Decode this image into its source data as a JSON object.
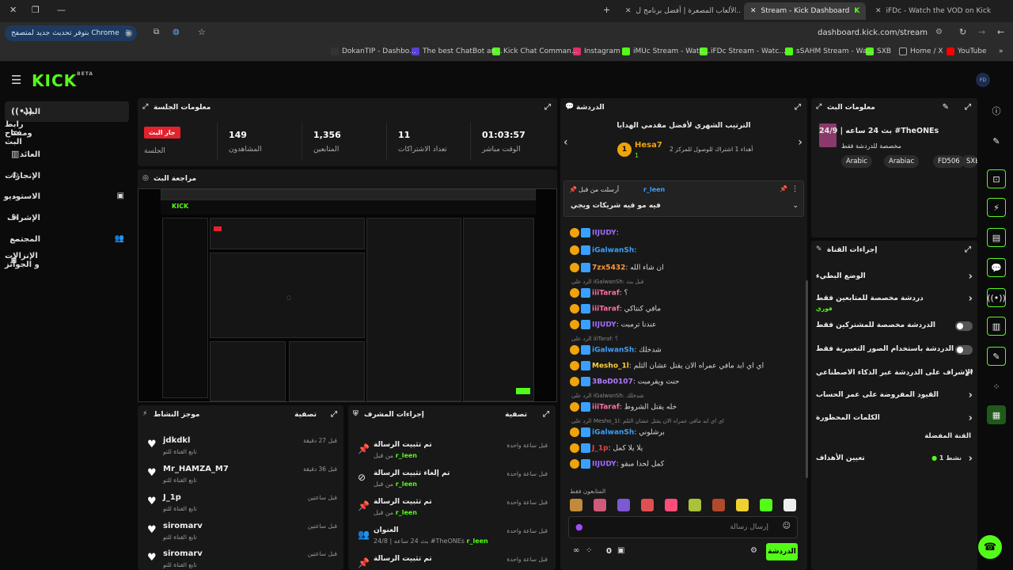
{
  "browser": {
    "tabs": [
      {
        "label": "iFDc - Watch the VOD on Kick"
      },
      {
        "label": "Stream - Kick Dashboard"
      },
      {
        "label": "الألعاب المصعرة | أفضل برنامج ل..."
      }
    ],
    "update_label": "بتوفر تحديث جديد لمتصفح Chrome",
    "url": "dashboard.kick.com/stream",
    "bookmarks": [
      "YouTube",
      "Home / X",
      "SXB",
      "sSAHM Stream - Wa...",
      "iFDc Stream - Watc...",
      "iMUc Stream - Watc...",
      "Instagram",
      "Kick Chat Comman...",
      "The best ChatBot an...",
      "DokanTIP - Dashbo..."
    ]
  },
  "nav": {
    "logo": "KICK",
    "logo_badge": "BETA",
    "avatar": "FD"
  },
  "sidebar": {
    "items": [
      {
        "label": "البث",
        "icon": "live-icon"
      },
      {
        "label": "رابط ومفتاح البث",
        "icon": "link-icon"
      },
      {
        "label": "العائد",
        "icon": "revenue-icon"
      },
      {
        "label": "الإنجازات",
        "icon": "trophy-icon"
      },
      {
        "label": "الاستوديو",
        "icon": "studio-icon"
      },
      {
        "label": "الإشراف",
        "icon": "wrench-icon"
      },
      {
        "label": "المجتمع",
        "icon": "community-icon"
      },
      {
        "label": "الإنزالات و الجوائز",
        "icon": "gift-icon"
      }
    ]
  },
  "session": {
    "title": "معلومات الجلسة",
    "badge": "جار البث",
    "badge_label": "الجلسة",
    "stats": [
      {
        "value": "149",
        "label": "المشاهدون"
      },
      {
        "value": "1,356",
        "label": "المتابعين"
      },
      {
        "value": "11",
        "label": "تعداد الاشتراكات"
      },
      {
        "value": "01:03:57",
        "label": "الوقت مباشر"
      }
    ]
  },
  "preview": {
    "title": "مراجعة البث"
  },
  "activity": {
    "title": "موجز النشاط",
    "filter": "تصفية",
    "rows": [
      {
        "name": "jdkdkl",
        "sub": "تابع القناة للتو",
        "time": "قبل 27 دقيقة"
      },
      {
        "name": "Mr_HAMZA_M7",
        "sub": "تابع القناة للتو",
        "time": "قبل 36 دقيقة"
      },
      {
        "name": "J_1p",
        "sub": "تابع القناة للتو",
        "time": "قبل ساعتين"
      },
      {
        "name": "siromarv",
        "sub": "تابع القناة للتو",
        "time": "قبل ساعتين"
      },
      {
        "name": "siromarv",
        "sub": "تابع القناة للتو",
        "time": "قبل ساعتين"
      }
    ]
  },
  "modactions": {
    "title": "إجراءات المشرف",
    "filter": "تصفية",
    "rows": [
      {
        "title": "تم تثبيت الرسالة",
        "by": "من قبل",
        "user": "r_leen",
        "time": "قبل ساعة واحدة",
        "icon": "pin-icon"
      },
      {
        "title": "تم إلغاء تثبيت الرسالة",
        "by": "من قبل",
        "user": "r_leen",
        "time": "قبل ساعة واحدة",
        "icon": "unpin-icon"
      },
      {
        "title": "تم تثبيت الرسالة",
        "by": "من قبل",
        "user": "r_leen",
        "time": "قبل ساعة واحدة",
        "icon": "pin-icon"
      },
      {
        "title": "العنوان",
        "by": "بث 24 ساعه | 24/8 #TheONEs",
        "user": "r_leen",
        "time": "قبل ساعة واحدة",
        "icon": "title-icon"
      },
      {
        "title": "تم تثبيت الرسالة",
        "by": "",
        "user": "",
        "time": "قبل ساعة واحدة",
        "icon": "pin-icon"
      }
    ]
  },
  "chat": {
    "title": "الدردشة",
    "leaderboard_title": "الترتيب الشهري لأفضل مقدمي الهدايا",
    "leader_name": "Hesa7",
    "leader_rank": "1",
    "leader_count": "1",
    "leader_sub": "أهداء 1 اشتراك للوصول للمركز 2",
    "pinned_by": "أرسلت من قبل",
    "pinned_user": "r_leen",
    "pinned_text": "فيه مو فيه شريكات ويجي",
    "messages": [
      {
        "user": "IIJUDY",
        "color": "#a16bff",
        "text": ""
      },
      {
        "user": "iGalwanSh",
        "color": "#3aa0ff",
        "text": ""
      },
      {
        "user": "7zx5432",
        "color": "#ff9b3d",
        "text": "ان شاء الله"
      },
      {
        "reply": "الرد على iGalwanSh: قبل بث",
        "user": "iiiTaraf",
        "color": "#ff6fa8",
        "text": "؟"
      },
      {
        "user": "iiiTaraf",
        "color": "#ff6fa8",
        "text": "مافي كنتاكي"
      },
      {
        "user": "IIJUDY",
        "color": "#a16bff",
        "text": "عندنا ترمبت"
      },
      {
        "reply": "الرد على iiiTaraf: ؟",
        "user": "iGalwanSh",
        "color": "#3aa0ff",
        "text": "شدخلك"
      },
      {
        "user": "Mesho_1l",
        "color": "#ffcf3d",
        "text": "اي اي ابد مافي عمراه الان يقتل عشان الثلم"
      },
      {
        "user": "3BoD0107",
        "color": "#b07cff",
        "text": "حنث ويقرمبت"
      },
      {
        "reply": "الرد على iGalwanSh: شدخلك",
        "user": "iiiTaraf",
        "color": "#ff6fa8",
        "text": "خله يقتل الشروط"
      },
      {
        "reply": "الرد على Mesho_1l: اي اي ابد مافي عمراه الان يقتل عشان الثلم",
        "user": "iGalwanSh",
        "color": "#3aa0ff",
        "text": "برشلوني"
      },
      {
        "user": "J_1p",
        "color": "#e14848",
        "text": "يلا يلا كمل"
      },
      {
        "user": "IIJUDY",
        "color": "#a16bff",
        "text": "كمل لحدا مبقو"
      }
    ],
    "followers_only": "المتابعون فقط",
    "input_placeholder": "إرسال رسالة",
    "send_label": "الدردشة",
    "count": "0"
  },
  "streaminfo": {
    "title": "معلومات البث",
    "stream_title": "بث 24 ساعه | 24/9 #TheONEs",
    "category": "مخصصة للدردشة فقط",
    "tags": [
      "Arabic",
      "Arabiac",
      "FD506",
      "SXB"
    ]
  },
  "channelactions": {
    "title": "إجراءات القناة",
    "rows": [
      {
        "label": "الوضع البطيء",
        "kind": "chev"
      },
      {
        "label": "دردشة مخصصة للمتابعين فقط",
        "sub": "فوري",
        "kind": "chev"
      },
      {
        "label": "الدردشة مخصصة للمشتركين فقط",
        "kind": "toggle"
      },
      {
        "label": "الدردشة باستخدام الصور التعبيرية فقط",
        "kind": "toggle"
      },
      {
        "label": "الإشراف على الدردشة عبر الذكاء الاصطناعي",
        "kind": "ext"
      },
      {
        "label": "القيود المفروضة على عمر الحساب",
        "kind": "chev"
      },
      {
        "label": "الكلمات المحظورة",
        "kind": "chev"
      }
    ],
    "favorites_title": "القنة المفضلة",
    "goals_label": "تعيين الأهداف",
    "goals_status": "نشط 1"
  }
}
